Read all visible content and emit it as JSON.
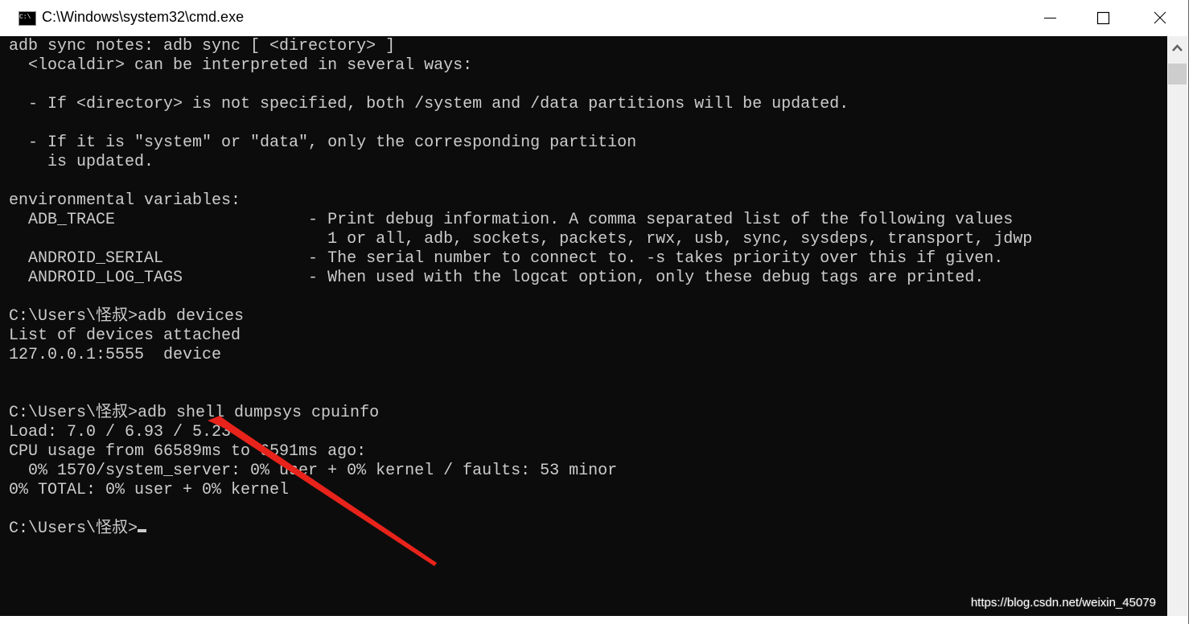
{
  "window": {
    "title": "C:\\Windows\\system32\\cmd.exe"
  },
  "console": {
    "lines": [
      "adb sync notes: adb sync [ <directory> ]",
      "  <localdir> can be interpreted in several ways:",
      "",
      "  - If <directory> is not specified, both /system and /data partitions will be updated.",
      "",
      "  - If it is \"system\" or \"data\", only the corresponding partition",
      "    is updated.",
      "",
      "environmental variables:",
      "  ADB_TRACE                    - Print debug information. A comma separated list of the following values",
      "                                 1 or all, adb, sockets, packets, rwx, usb, sync, sysdeps, transport, jdwp",
      "  ANDROID_SERIAL               - The serial number to connect to. -s takes priority over this if given.",
      "  ANDROID_LOG_TAGS             - When used with the logcat option, only these debug tags are printed.",
      "",
      "C:\\Users\\怪叔>adb devices",
      "List of devices attached",
      "127.0.0.1:5555  device",
      "",
      "",
      "C:\\Users\\怪叔>adb shell dumpsys cpuinfo",
      "Load: 7.0 / 6.93 / 5.23",
      "CPU usage from 66589ms to 6591ms ago:",
      "  0% 1570/system_server: 0% user + 0% kernel / faults: 53 minor",
      "0% TOTAL: 0% user + 0% kernel",
      "",
      "C:\\Users\\怪叔>"
    ]
  },
  "watermark": "https://blog.csdn.net/weixin_45079",
  "colors": {
    "console_bg": "#0c0c0c",
    "console_fg": "#cccccc",
    "arrow": "#e8231b"
  }
}
